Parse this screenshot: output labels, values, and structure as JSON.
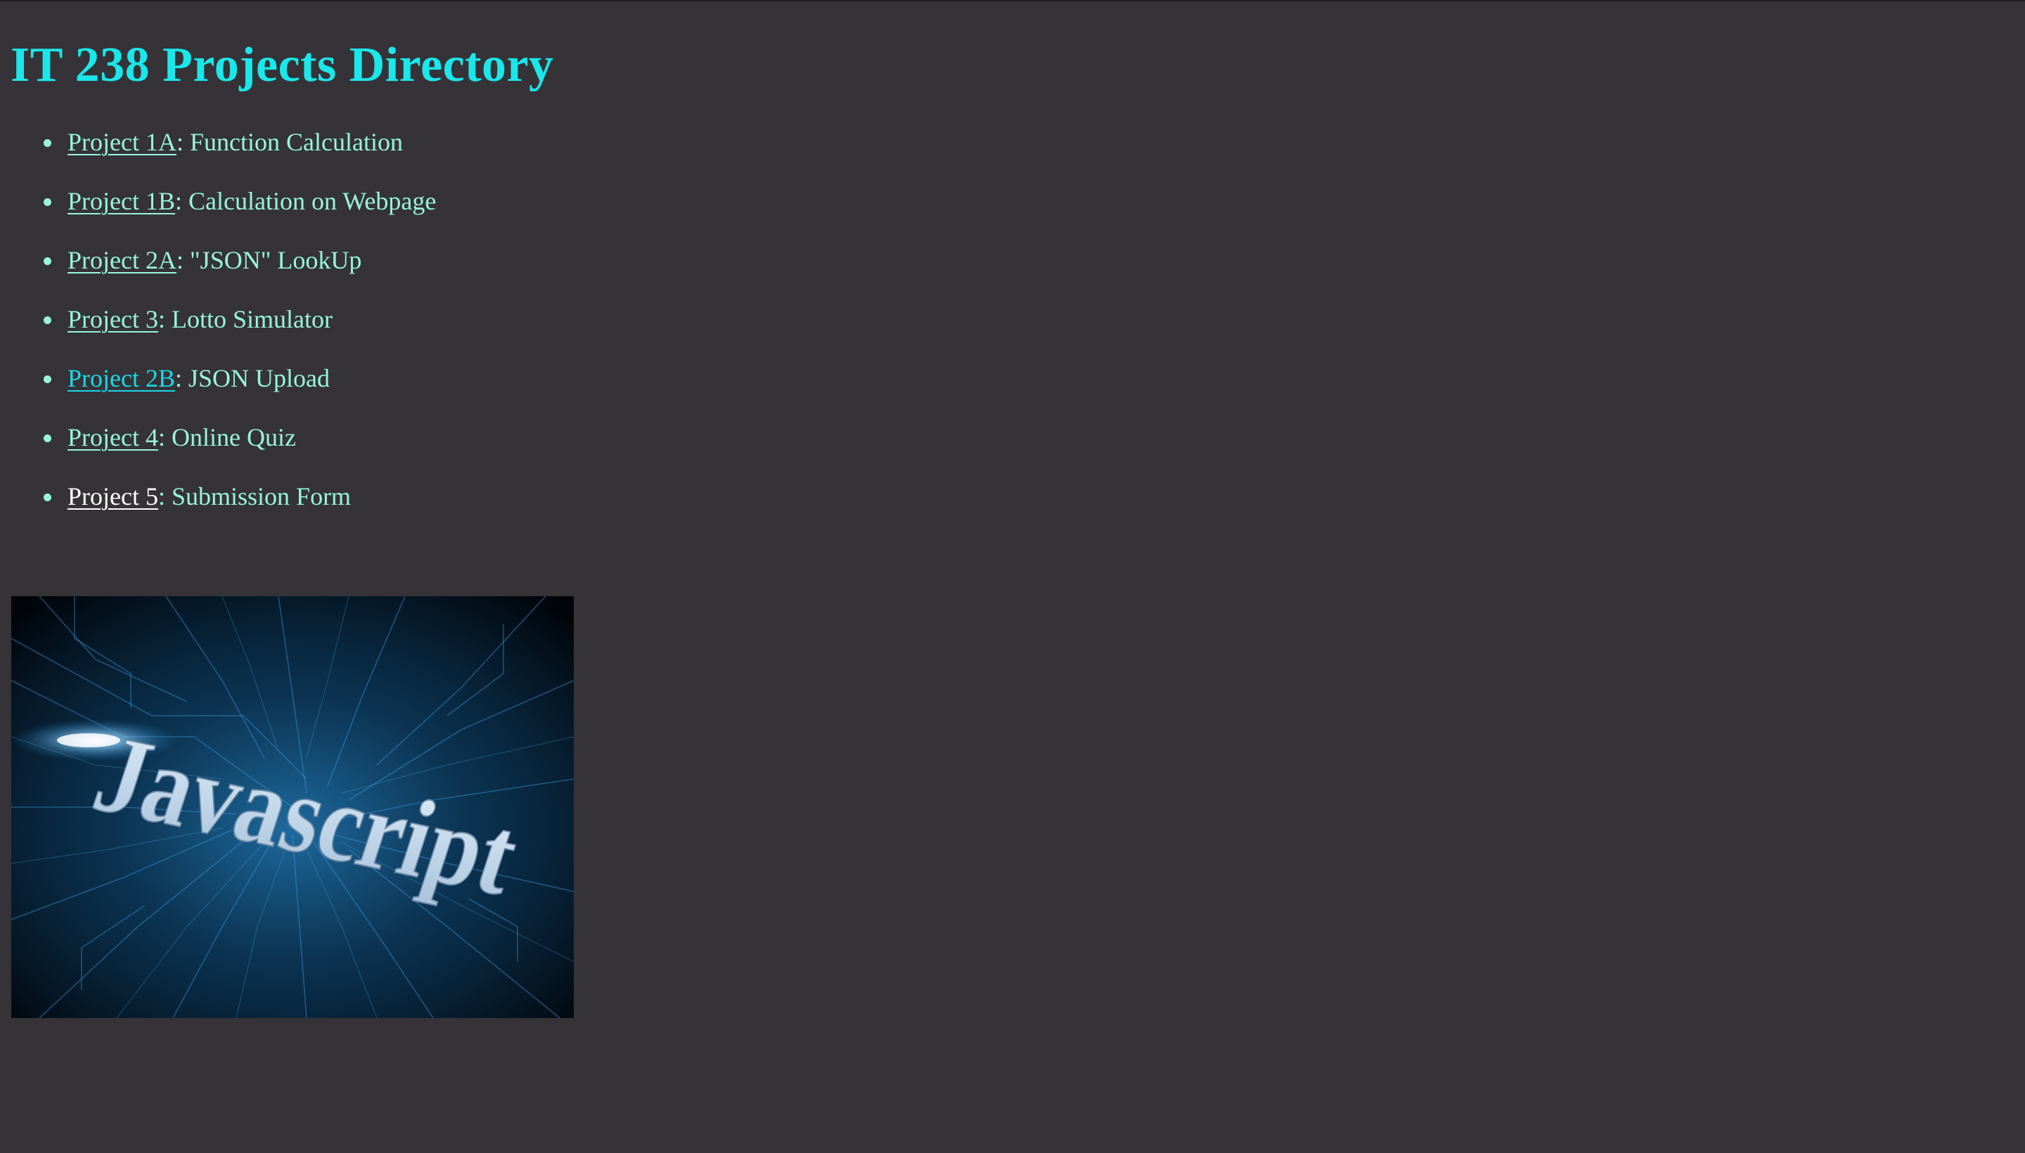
{
  "page": {
    "title": "IT 238 Projects Directory"
  },
  "projects": [
    {
      "link": "Project 1A",
      "description": "Function Calculation"
    },
    {
      "link": "Project 1B",
      "description": "Calculation on Webpage"
    },
    {
      "link": "Project 2A",
      "description": "\"JSON\" LookUp"
    },
    {
      "link": "Project 3",
      "description": "Lotto Simulator"
    },
    {
      "link": "Project 2B",
      "description": "JSON Upload"
    },
    {
      "link": "Project 4",
      "description": "Online Quiz"
    },
    {
      "link": "Project 5",
      "description": "Submission Form"
    }
  ],
  "image": {
    "text": "Javascript",
    "alt": "Javascript"
  },
  "colors": {
    "background": "#353337",
    "title": "#1ae7ea",
    "list_text": "#98f5dc",
    "link_visited": "#1ad8ea",
    "link_active": "#ffffff"
  }
}
